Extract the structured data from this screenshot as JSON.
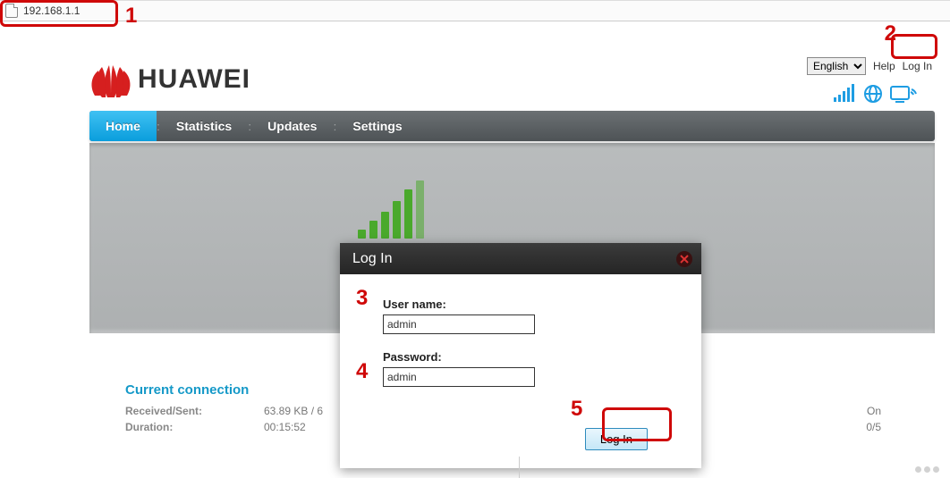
{
  "address_bar": {
    "url": "192.168.1.1"
  },
  "top": {
    "language_options": [
      "English"
    ],
    "language_selected": "English",
    "help": "Help",
    "login": "Log In"
  },
  "logo": {
    "text": "HUAWEI"
  },
  "nav": {
    "tabs": [
      {
        "label": "Home",
        "active": true
      },
      {
        "label": "Statistics",
        "active": false
      },
      {
        "label": "Updates",
        "active": false
      },
      {
        "label": "Settings",
        "active": false
      }
    ]
  },
  "status": {
    "title": "Current connection",
    "rows": [
      {
        "label": "Received/Sent:",
        "value": "63.89 KB / 6",
        "right": "On"
      },
      {
        "label": "Duration:",
        "value": "00:15:52",
        "right": "0/5"
      }
    ]
  },
  "modal": {
    "title": "Log In",
    "username_label": "User name:",
    "username_value": "admin",
    "password_label": "Password:",
    "password_value": "admin",
    "button": "Log In"
  },
  "annotations": {
    "n1": "1",
    "n2": "2",
    "n3": "3",
    "n4": "4",
    "n5": "5"
  }
}
